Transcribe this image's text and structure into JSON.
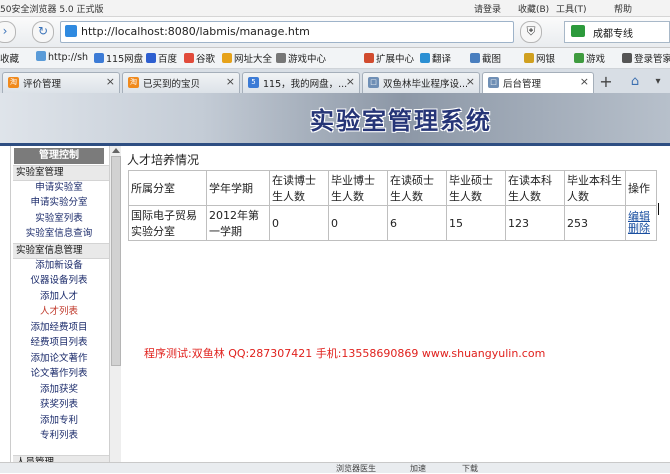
{
  "browser": {
    "title": "50安全浏览器 5.0 正式版",
    "login": "请登录",
    "favorites": "收藏(B)",
    "tools": "工具(T)",
    "help": "帮助",
    "address": "http://localhost:8080/labmis/manage.htm",
    "search_label": "成都专线",
    "bookmarks": [
      "收藏",
      "http://sh",
      "115网盘",
      "百度",
      "谷歌",
      "网址大全",
      "游戏中心"
    ],
    "extensions": [
      "扩展中心",
      "翻译",
      "截图",
      "网银",
      "游戏",
      "登录管家"
    ],
    "tabs": [
      {
        "label": "评价管理"
      },
      {
        "label": "已买到的宝贝"
      },
      {
        "label": "115，我的网盘，..."
      },
      {
        "label": "双鱼林毕业程序设..."
      },
      {
        "label": "后台管理"
      }
    ],
    "status": [
      "浏览器医生",
      "加速",
      "下载"
    ]
  },
  "banner_title": "实验室管理系统",
  "sidebar": {
    "header": "管理控制",
    "groups": [
      {
        "label": "实验室管理"
      },
      {
        "label": "实验室信息管理"
      },
      {
        "label": "人员管理"
      }
    ],
    "items": [
      "申请实验室",
      "申请实验分室",
      "实验室列表",
      "实验室信息查询",
      "添加新设备",
      "仪器设备列表",
      "添加人才",
      "人才列表",
      "添加经费项目",
      "经费项目列表",
      "添加论文著作",
      "论文著作列表",
      "添加获奖",
      "获奖列表",
      "添加专利",
      "专利列表"
    ]
  },
  "main": {
    "caption": "人才培养情况",
    "columns": [
      "所属分室",
      "学年学期",
      "在读博士生人数",
      "毕业博士生人数",
      "在读硕士生人数",
      "毕业硕士生人数",
      "在读本科生人数",
      "毕业本科生人数",
      "操作"
    ],
    "rows": [
      {
        "room": "国际电子贸易实验分室",
        "term": "2012年第一学期",
        "v1": "0",
        "v2": "0",
        "v3": "6",
        "v4": "15",
        "v5": "123",
        "v6": "253",
        "edit": "编辑",
        "delete": "删除"
      }
    ],
    "credit": "程序测试:双鱼林 QQ:287307421 手机:13558690869 www.shuangyulin.com"
  }
}
